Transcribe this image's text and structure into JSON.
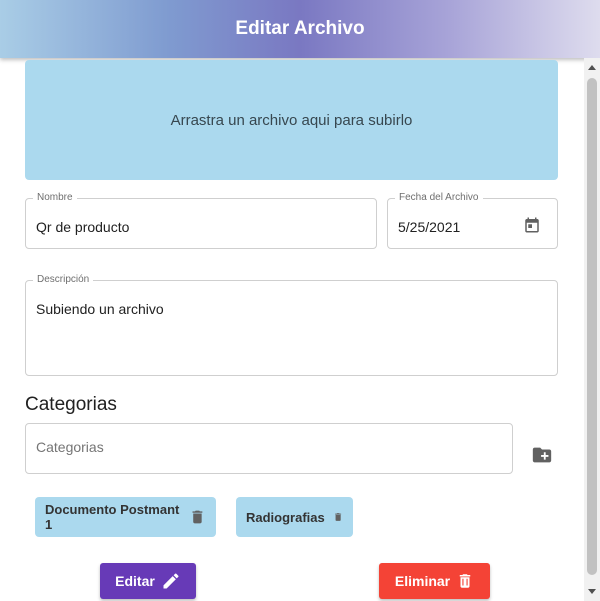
{
  "dialog": {
    "title": "Editar Archivo"
  },
  "dropzone": {
    "text": "Arrastra un archivo aqui para subirlo"
  },
  "form": {
    "nombre": {
      "label": "Nombre",
      "value": "Qr de producto"
    },
    "fecha": {
      "label": "Fecha del Archivo",
      "value": "5/25/2021",
      "icon": "calendar-icon"
    },
    "descripcion": {
      "label": "Descripción",
      "value": "Subiendo un archivo"
    }
  },
  "categorias": {
    "title": "Categorias",
    "placeholder": "Categorias",
    "add_icon": "folder-add-icon",
    "chips": [
      {
        "label": "Documento Postmant 1",
        "icon": "trash-icon"
      },
      {
        "label": "Radiografias",
        "icon": "trash-icon"
      }
    ]
  },
  "actions": {
    "edit_label": "Editar",
    "edit_icon": "pencil-icon",
    "delete_label": "Eliminar",
    "delete_icon": "trash-icon"
  },
  "colors": {
    "accent_edit": "#673ab7",
    "accent_delete": "#f44336",
    "dropzone_bg": "#abd9ee",
    "chip_bg": "#abd9ee"
  }
}
